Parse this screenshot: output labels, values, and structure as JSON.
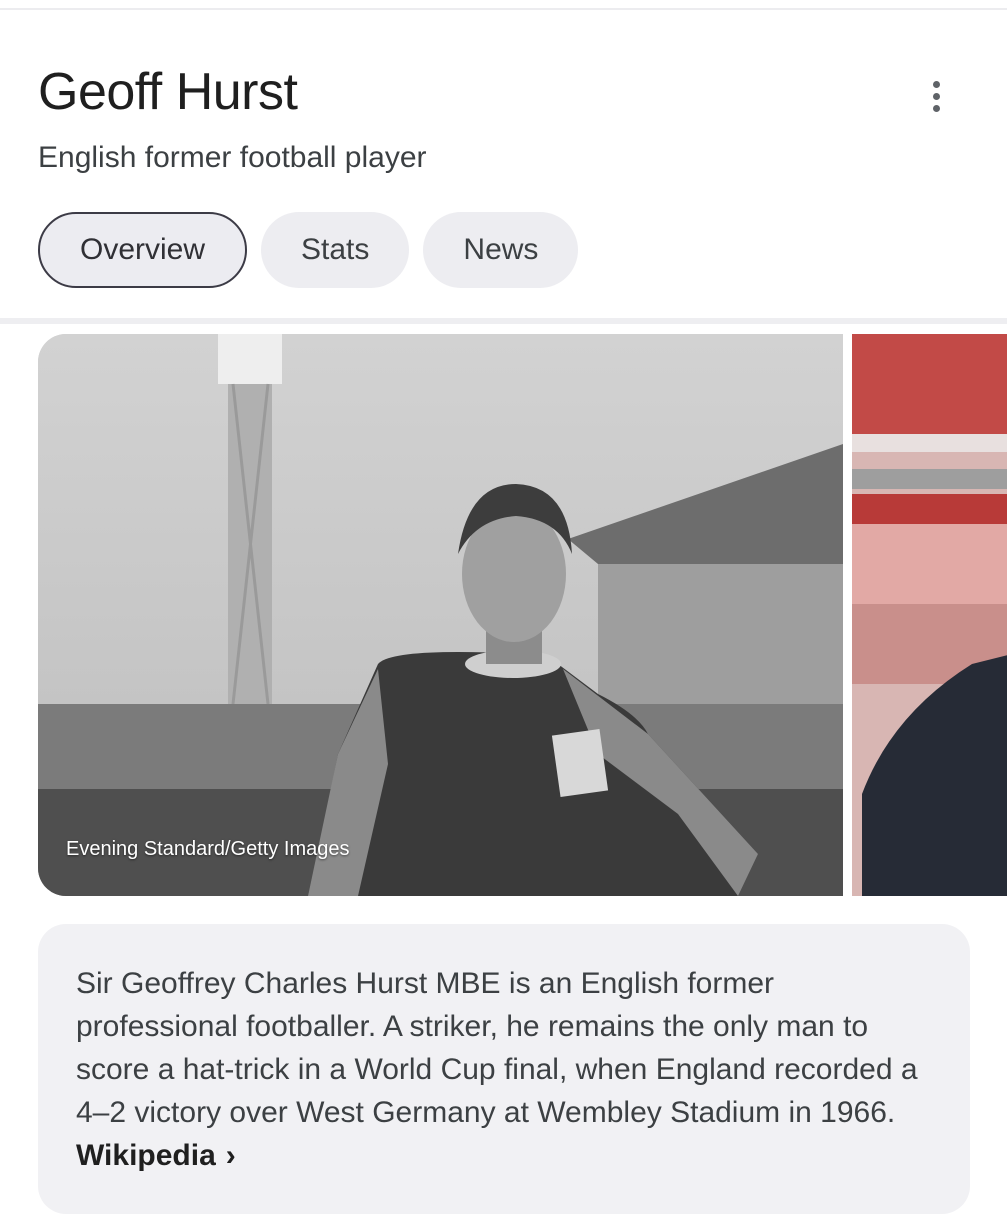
{
  "header": {
    "title": "Geoff Hurst",
    "subtitle": "English former football player",
    "more_icon": "more-vert-icon"
  },
  "tabs": [
    {
      "label": "Overview",
      "active": true
    },
    {
      "label": "Stats",
      "active": false
    },
    {
      "label": "News",
      "active": false
    }
  ],
  "images": {
    "main_credit": "Evening Standard/Getty Images"
  },
  "description": {
    "text": "Sir Geoffrey Charles Hurst MBE is an English former professional footballer. A striker, he remains the only man to score a hat-trick in a World Cup final, when England recorded a 4–2 victory over West Germany at Wembley Stadium in 1966.",
    "source_label": "Wikipedia",
    "source_chevron": "›"
  }
}
